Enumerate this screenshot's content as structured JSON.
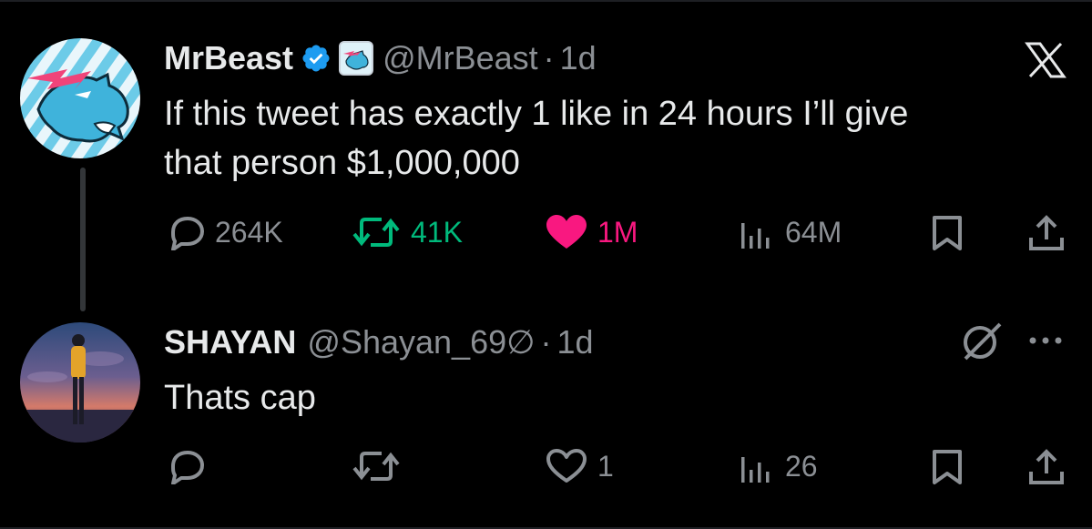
{
  "tweet": {
    "author_name": "MrBeast",
    "author_handle": "@MrBeast",
    "separator": "·",
    "time": "1d",
    "text_line1": "If this tweet has exactly 1 like in 24 hours I’ll give",
    "text_line2": "that person $1,000,000",
    "replies": "264K",
    "reposts": "41K",
    "likes": "1M",
    "views": "64M",
    "liked": true,
    "icons": {
      "logo": "x-logo-icon",
      "verified": "verified-badge-icon",
      "affiliate": "mrbeast-affiliate-badge",
      "reply": "reply-icon",
      "repost": "repost-icon",
      "like": "heart-icon",
      "views": "views-icon",
      "bookmark": "bookmark-icon",
      "share": "share-icon"
    }
  },
  "reply": {
    "author_name": "SHAYAN",
    "author_handle": "@Shayan_69∅",
    "separator": "·",
    "time": "1d",
    "text": "Thats cap",
    "replies": "",
    "reposts": "",
    "likes": "1",
    "views": "26",
    "icons": {
      "grok": "grok-icon",
      "more": "more-options-icon"
    }
  },
  "colors": {
    "background": "#000000",
    "text": "#e7e9ea",
    "muted": "#8b8f94",
    "verified": "#1d9bf0",
    "repost_active": "#00ba7c",
    "like_active": "#f91880",
    "thread_line": "#333639"
  }
}
